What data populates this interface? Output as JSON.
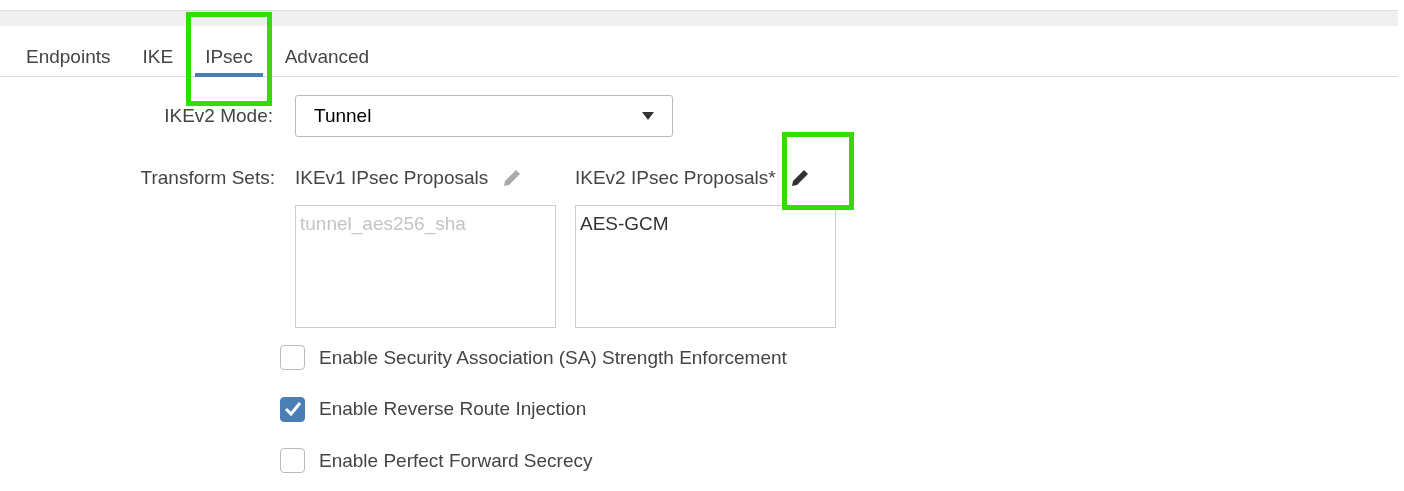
{
  "tabs": [
    {
      "label": "Endpoints",
      "selected": false,
      "highlighted": false
    },
    {
      "label": "IKE",
      "selected": false,
      "highlighted": false
    },
    {
      "label": "IPsec",
      "selected": true,
      "highlighted": true
    },
    {
      "label": "Advanced",
      "selected": false,
      "highlighted": false
    }
  ],
  "mode": {
    "label": "IKEv2 Mode:",
    "value": "Tunnel"
  },
  "transform_sets": {
    "label": "Transform Sets:",
    "proposals": [
      {
        "title": "IKEv1 IPsec Proposals",
        "disabled": true,
        "highlighted": false,
        "items": [
          "tunnel_aes256_sha"
        ]
      },
      {
        "title": "IKEv2 IPsec Proposals*",
        "disabled": false,
        "highlighted": true,
        "items": [
          "AES-GCM"
        ]
      }
    ]
  },
  "options": [
    {
      "label": "Enable Security Association (SA) Strength Enforcement",
      "checked": false
    },
    {
      "label": "Enable Reverse Route Injection",
      "checked": true
    },
    {
      "label": "Enable Perfect Forward Secrecy",
      "checked": false
    }
  ]
}
